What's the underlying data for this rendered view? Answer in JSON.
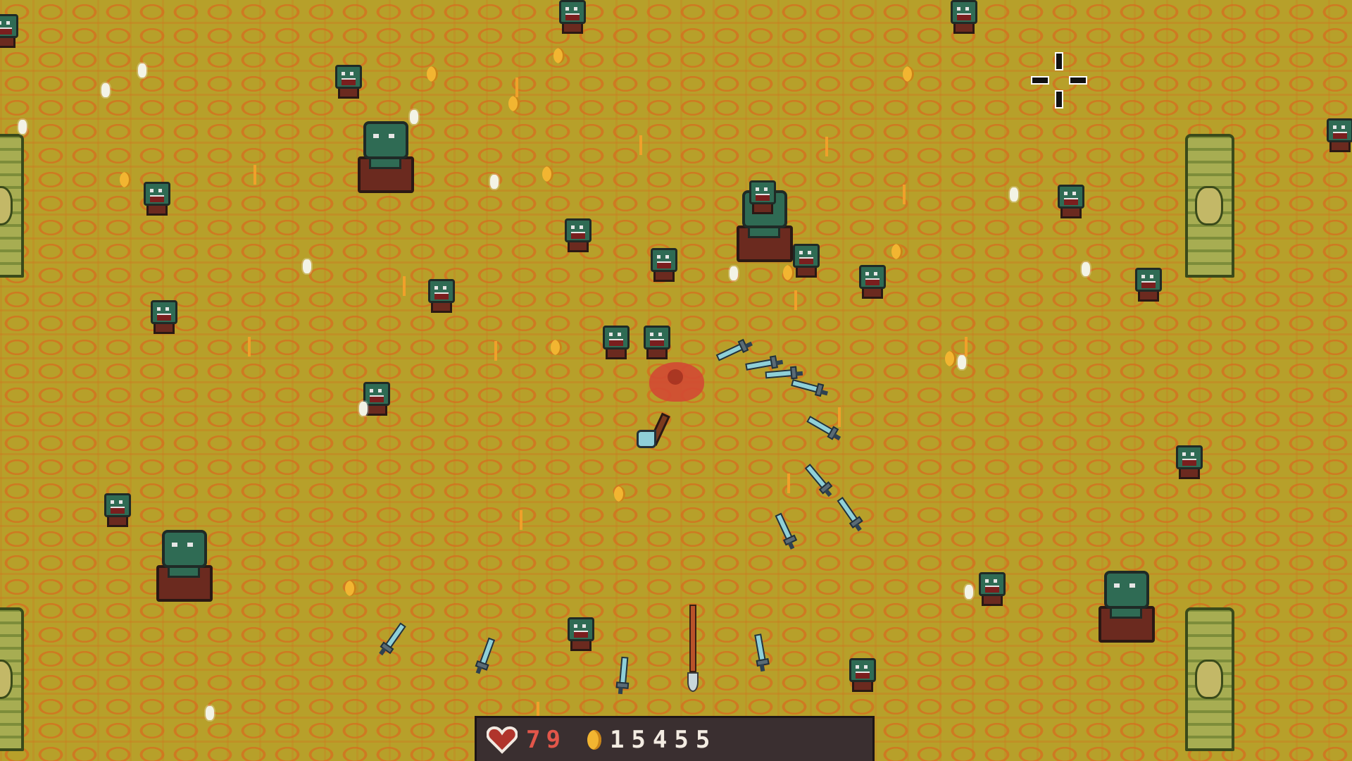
{
  "hud": {
    "health_value": "79",
    "gold_value": "15455",
    "heart_icon": "heart-icon",
    "coin_icon": "coin-icon"
  },
  "colors": {
    "ground": "#b7a02a",
    "ground_lines": "#d0731f",
    "hud_background": "#3a2f30",
    "health_text": "#e2564a",
    "gold_text": "#f3ece2",
    "enemy_skin": "#2f6b54",
    "enemy_robe": "#6b2a1f",
    "weapon_blade": "#8fd0d8",
    "blood": "#d34a33"
  },
  "entities": {
    "small_enemy_icon": "goblin-icon",
    "big_enemy_icon": "ogre-icon",
    "pillar_icon": "totem-pillar-icon",
    "gem_icon": "xp-gem-icon",
    "coin_drop_icon": "coin-drop-icon",
    "dagger_icon": "dagger-icon",
    "axe_icon": "axe-icon",
    "spear_icon": "spear-icon",
    "crosshair_icon": "crosshair-icon"
  }
}
